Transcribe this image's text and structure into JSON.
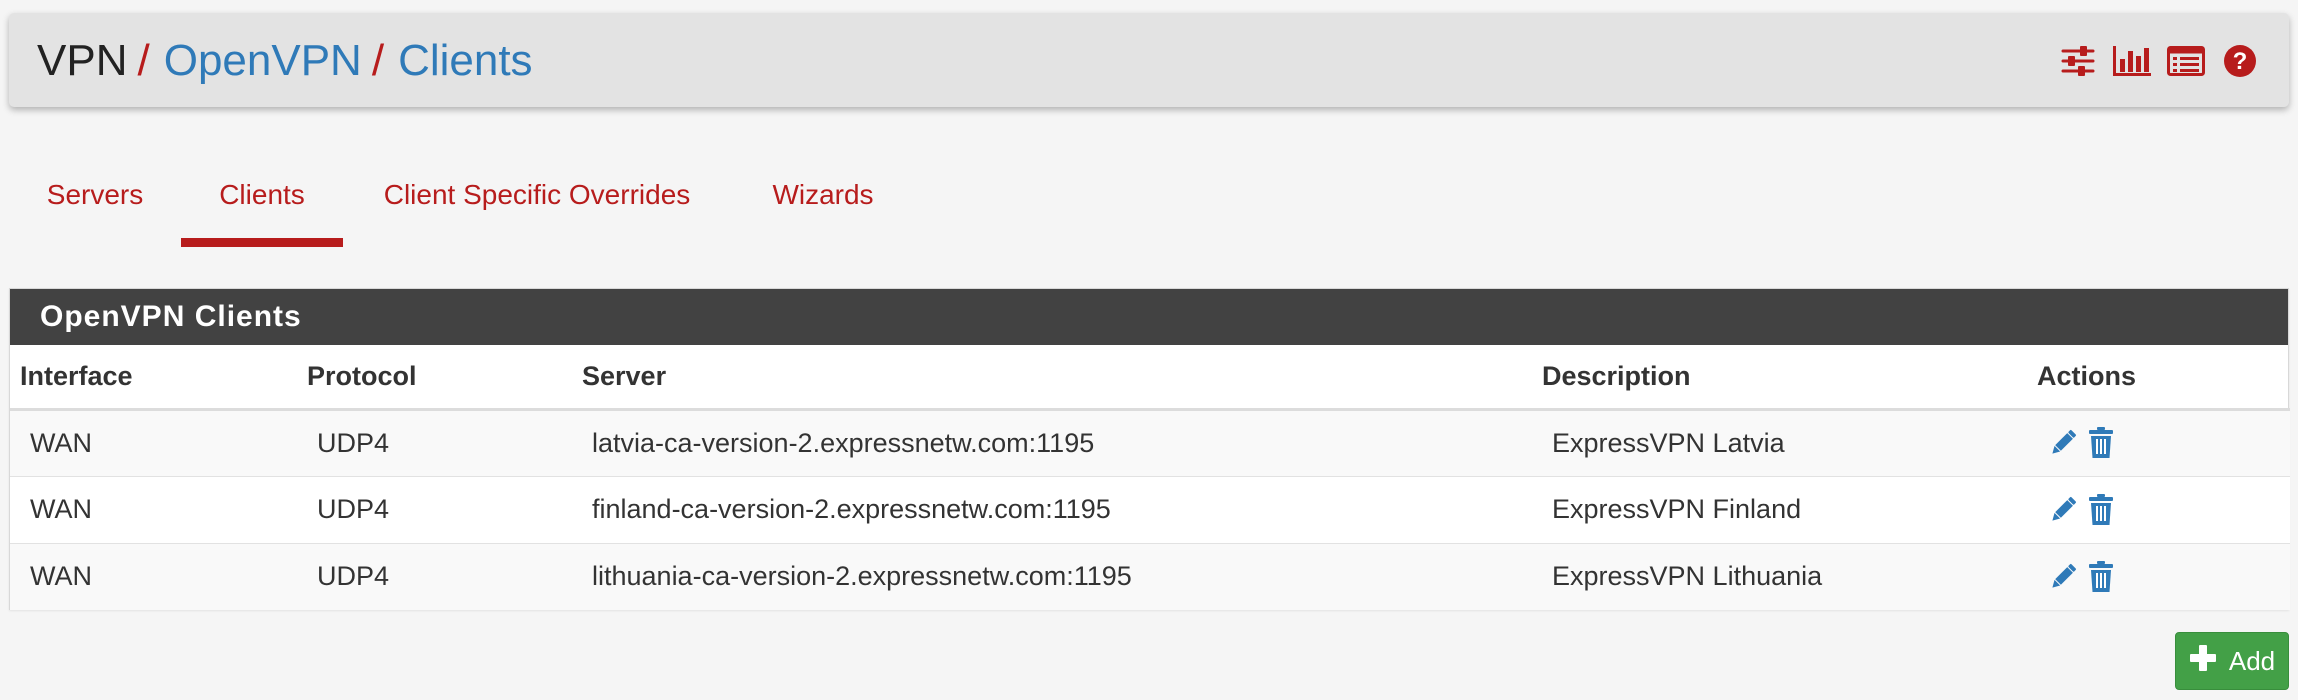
{
  "breadcrumb": {
    "root": "VPN",
    "separator": "/",
    "items": [
      "OpenVPN",
      "Clients"
    ]
  },
  "header_icons": [
    "sliders-icon",
    "bar-chart-icon",
    "log-list-icon",
    "help-icon"
  ],
  "tabs": [
    {
      "label": "Servers",
      "active": false
    },
    {
      "label": "Clients",
      "active": true
    },
    {
      "label": "Client Specific Overrides",
      "active": false
    },
    {
      "label": "Wizards",
      "active": false
    }
  ],
  "panel": {
    "title": "OpenVPN Clients",
    "columns": [
      "Interface",
      "Protocol",
      "Server",
      "Description",
      "Actions"
    ],
    "rows": [
      {
        "interface": "WAN",
        "protocol": "UDP4",
        "server": "latvia-ca-version-2.expressnetw.com:1195",
        "description": "ExpressVPN Latvia"
      },
      {
        "interface": "WAN",
        "protocol": "UDP4",
        "server": "finland-ca-version-2.expressnetw.com:1195",
        "description": "ExpressVPN Finland"
      },
      {
        "interface": "WAN",
        "protocol": "UDP4",
        "server": "lithuania-ca-version-2.expressnetw.com:1195",
        "description": "ExpressVPN Lithuania"
      }
    ]
  },
  "add_button": {
    "label": "Add"
  },
  "colors": {
    "accent_red": "#b71c1c",
    "link_blue": "#2f7ab8",
    "panel_header": "#424242",
    "add_green": "#43a047"
  }
}
